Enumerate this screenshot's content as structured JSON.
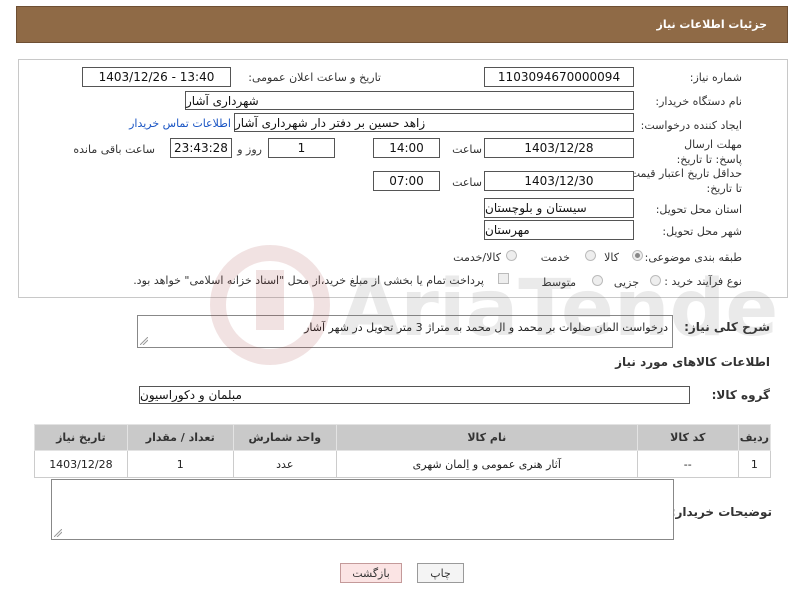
{
  "header": {
    "title": "جزئیات اطلاعات نیاز"
  },
  "form": {
    "need_number_label": "شماره نیاز:",
    "need_number": "1103094670000094",
    "announce_label": "تاریخ و ساعت اعلان عمومی:",
    "announce_value": "1403/12/26 - 13:40",
    "buyer_org_label": "نام دستگاه خریدار:",
    "buyer_org": "شهرداری آشار",
    "creator_label": "ایجاد کننده درخواست:",
    "creator": "زاهد حسین بر دفتر دار شهرداری آشار",
    "contact_link": "اطلاعات تماس خریدار",
    "deadline_label": "مهلت ارسال پاسخ: تا تاریخ:",
    "deadline_date": "1403/12/28",
    "time_label": "ساعت",
    "deadline_time": "14:00",
    "days_value": "1",
    "days_label": "روز و",
    "remaining_value": "23:43:28",
    "remaining_label": "ساعت باقی مانده",
    "validity_label": "حداقل تاریخ اعتبار قیمت: تا تاریخ:",
    "validity_date": "1403/12/30",
    "validity_time": "07:00",
    "province_label": "استان محل تحویل:",
    "province": "سیستان و بلوچستان",
    "city_label": "شهر محل تحویل:",
    "city": "مهرستان",
    "category_label": "طبقه بندی موضوعی:",
    "category_options": [
      "کالا",
      "خدمت",
      "کالا/خدمت"
    ],
    "category_selected": "کالا",
    "process_label": "نوع فرآیند خرید :",
    "process_options": [
      "جزیی",
      "متوسط"
    ],
    "payment_note": "پرداخت تمام یا بخشی از مبلغ خرید،از محل \"اسناد خزانه اسلامی\" خواهد بود."
  },
  "description": {
    "label": "شرح کلی نیاز:",
    "text": "درخواست المان صلوات بر محمد و ال محمد به متراژ 3 متر  تحویل در شهر آشار"
  },
  "goods": {
    "section_title": "اطلاعات کالاهای مورد نیاز",
    "group_label": "گروه کالا:",
    "group_value": "مبلمان و دکوراسیون",
    "columns": [
      "ردیف",
      "کد کالا",
      "نام کالا",
      "واحد شمارش",
      "تعداد / مقدار",
      "تاریخ نیاز"
    ],
    "rows": [
      [
        "1",
        "--",
        "آثار هنری عمومی و اِلمان شهری",
        "عدد",
        "1",
        "1403/12/28"
      ]
    ]
  },
  "buyer_notes_label": "توضیحات خریدار:",
  "buttons": {
    "print": "چاپ",
    "back": "بازگشت"
  },
  "watermark": "AriaTender.net"
}
